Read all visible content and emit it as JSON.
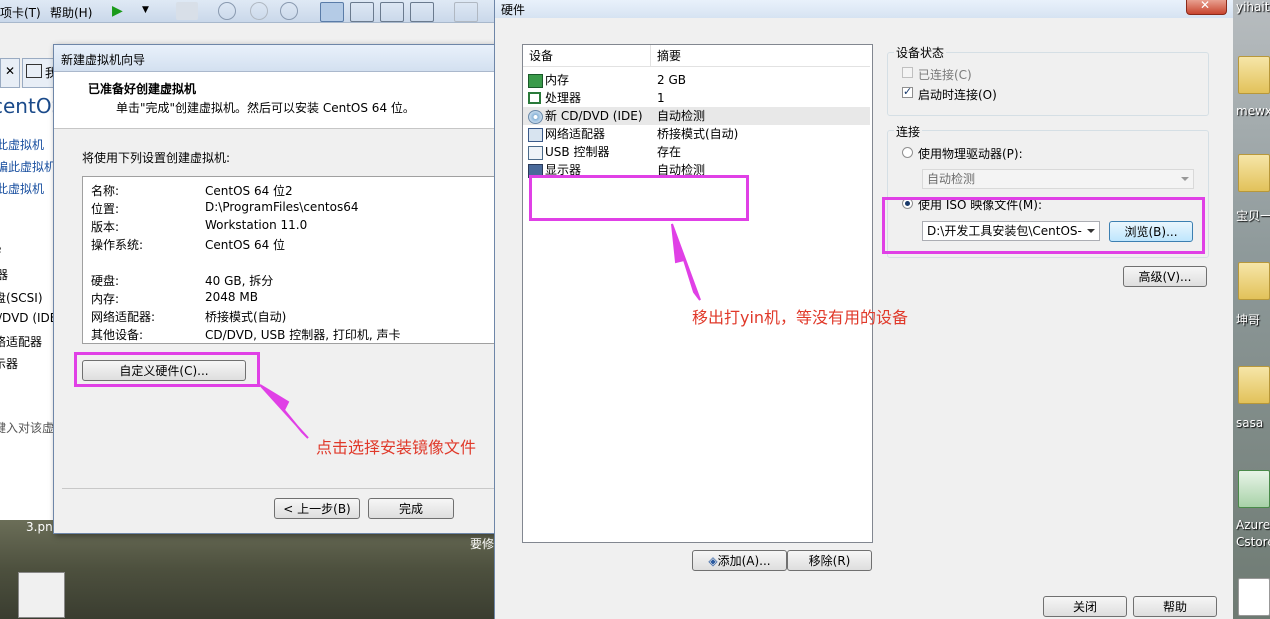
{
  "vmware": {
    "menus": [
      "项卡(T)",
      "帮助(H)"
    ],
    "tab_partial": "我",
    "left_items": [
      "centOS",
      "此虚拟机",
      "编此虚拟机设",
      "此虚拟机",
      "e",
      "器",
      "盘(SCSI)",
      "/DVD (IDE",
      "络适配器",
      "示器",
      "键入对该虚"
    ],
    "taskbar_file": "3.png",
    "taskbar_partial": "要修"
  },
  "wizard": {
    "title": "新建虚拟机向导",
    "heading": "已准备好创建虚拟机",
    "subheading": "单击\"完成\"创建虚拟机。然后可以安装 CentOS 64 位。",
    "intro": "将使用下列设置创建虚拟机:",
    "summary": [
      {
        "label": "名称:",
        "value": "CentOS 64 位2"
      },
      {
        "label": "位置:",
        "value": "D:\\ProgramFiles\\centos64"
      },
      {
        "label": "版本:",
        "value": "Workstation 11.0"
      },
      {
        "label": "操作系统:",
        "value": "CentOS 64 位"
      },
      {
        "label": "硬盘:",
        "value": "40 GB, 拆分"
      },
      {
        "label": "内存:",
        "value": "2048 MB"
      },
      {
        "label": "网络适配器:",
        "value": "桥接模式(自动)"
      },
      {
        "label": "其他设备:",
        "value": "CD/DVD, USB 控制器, 打印机, 声卡"
      }
    ],
    "customize_button": "自定义硬件(C)...",
    "back_button": "< 上一步(B)",
    "finish_button": "完成"
  },
  "annotations": {
    "left_note": "点击选择安装镜像文件",
    "right_note": "移出打yin机，等没有用的设备",
    "color": "#e040e6",
    "text_color": "#e0392a"
  },
  "hardware": {
    "title": "硬件",
    "columns": [
      "设备",
      "摘要"
    ],
    "devices": [
      {
        "name": "内存",
        "summary": "2 GB",
        "icon": "memory-icon"
      },
      {
        "name": "处理器",
        "summary": "1",
        "icon": "cpu-icon"
      },
      {
        "name": "新 CD/DVD (IDE)",
        "summary": "自动检测",
        "icon": "cd-icon",
        "selected": true
      },
      {
        "name": "网络适配器",
        "summary": "桥接模式(自动)",
        "icon": "network-icon"
      },
      {
        "name": "USB 控制器",
        "summary": "存在",
        "icon": "usb-icon"
      },
      {
        "name": "显示器",
        "summary": "自动检测",
        "icon": "display-icon"
      }
    ],
    "add_button": "添加(A)...",
    "remove_button": "移除(R)",
    "device_status": {
      "title": "设备状态",
      "connected": "已连接(C)",
      "connected_checked": false,
      "connect_at_power_on": "启动时连接(O)",
      "connect_at_power_on_checked": true
    },
    "connection": {
      "title": "连接",
      "physical_drive": "使用物理驱动器(P):",
      "physical_drive_value": "自动检测",
      "iso": "使用 ISO 映像文件(M):",
      "iso_path": "D:\\开发工具安装包\\CentOS-",
      "browse_button": "浏览(B)..."
    },
    "advanced_button": "高级(V)...",
    "close_button": "关闭",
    "help_button": "帮助"
  },
  "desktop": {
    "title_partial": "yihaita",
    "labels": [
      "mewx",
      "宝贝一",
      "坤哥",
      "sasa",
      "Azure",
      "Cstore"
    ]
  }
}
